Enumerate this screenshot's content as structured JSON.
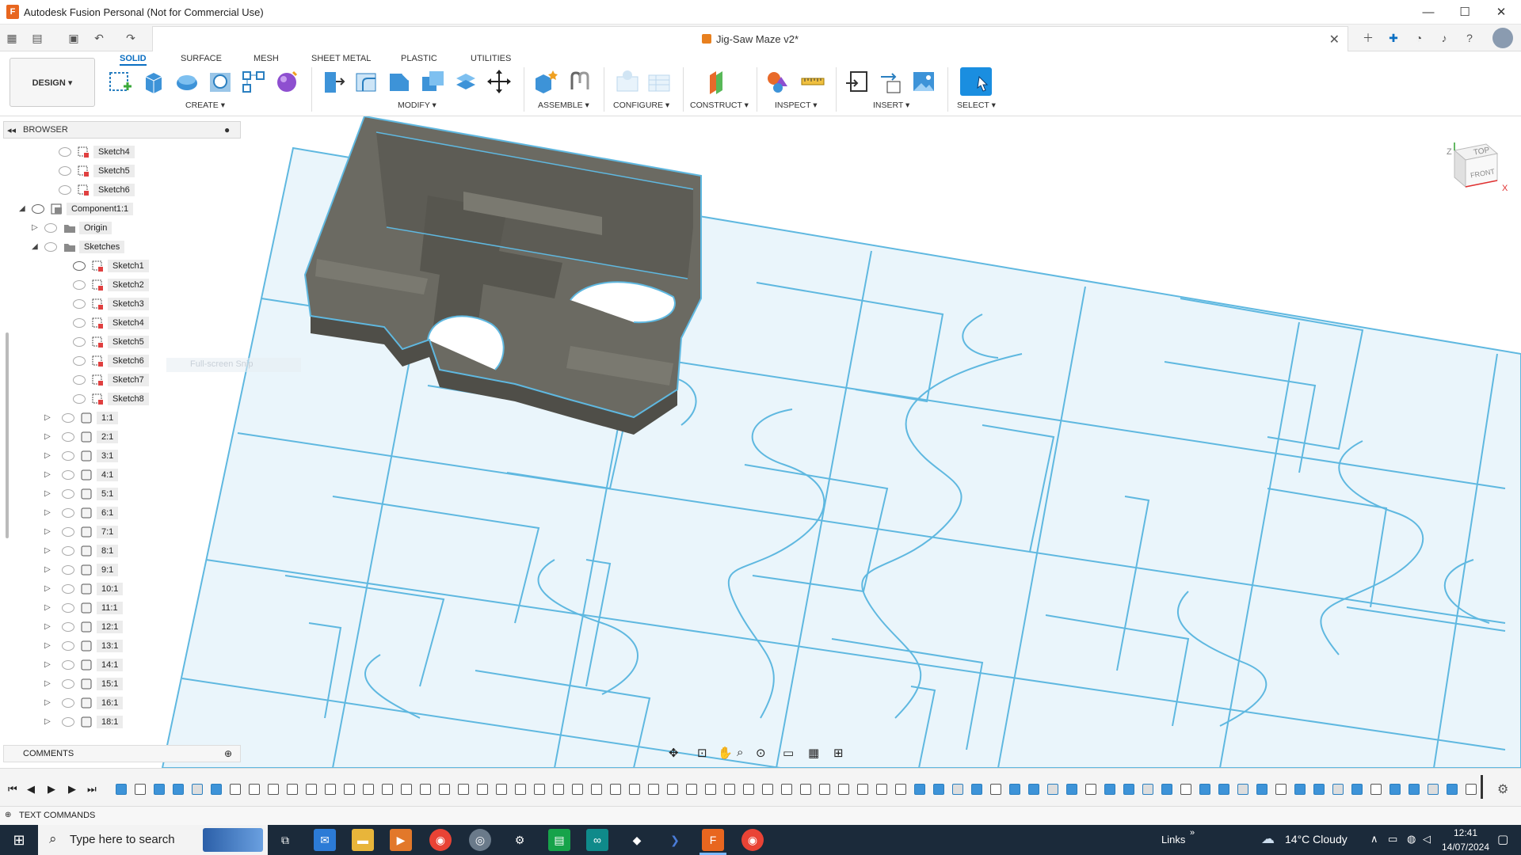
{
  "window": {
    "title": "Autodesk Fusion Personal (Not for Commercial Use)",
    "min": "—",
    "max": "☐",
    "close": "✕"
  },
  "document": {
    "tab_title": "Jig-Saw Maze v2*",
    "close": "✕"
  },
  "ribbon": {
    "workspace": "DESIGN ▾",
    "tabs": [
      "SOLID",
      "SURFACE",
      "MESH",
      "SHEET METAL",
      "PLASTIC",
      "UTILITIES"
    ],
    "active_tab": "SOLID",
    "groups": [
      "CREATE ▾",
      "MODIFY ▾",
      "ASSEMBLE ▾",
      "CONFIGURE ▾",
      "CONSTRUCT ▾",
      "INSPECT ▾",
      "INSERT ▾",
      "SELECT ▾"
    ]
  },
  "browser": {
    "title": "BROWSER",
    "rows": [
      {
        "label": "Sketch4"
      },
      {
        "label": "Sketch5"
      },
      {
        "label": "Sketch6"
      },
      {
        "label": "Component1:1"
      },
      {
        "label": "Origin"
      },
      {
        "label": "Sketches"
      },
      {
        "label": "Sketch1"
      },
      {
        "label": "Sketch2"
      },
      {
        "label": "Sketch3"
      },
      {
        "label": "Sketch4"
      },
      {
        "label": "Sketch5"
      },
      {
        "label": "Sketch6"
      },
      {
        "label": "Sketch7"
      },
      {
        "label": "Sketch8"
      },
      {
        "label": "1:1"
      },
      {
        "label": "2:1"
      },
      {
        "label": "3:1"
      },
      {
        "label": "4:1"
      },
      {
        "label": "5:1"
      },
      {
        "label": "6:1"
      },
      {
        "label": "7:1"
      },
      {
        "label": "8:1"
      },
      {
        "label": "9:1"
      },
      {
        "label": "10:1"
      },
      {
        "label": "11:1"
      },
      {
        "label": "12:1"
      },
      {
        "label": "13:1"
      },
      {
        "label": "14:1"
      },
      {
        "label": "15:1"
      },
      {
        "label": "16:1"
      },
      {
        "label": "18:1"
      }
    ],
    "ghost_tooltip": "Full-screen Snip"
  },
  "comments": {
    "title": "COMMENTS"
  },
  "viewcube": {
    "top": "TOP",
    "front": "FRONT",
    "axis_x": "X",
    "axis_z": "Z"
  },
  "text_commands": {
    "title": "TEXT COMMANDS"
  },
  "taskbar": {
    "search_placeholder": "Type here to search",
    "links": "Links",
    "weather": "14°C  Cloudy",
    "time": "12:41",
    "date": "14/07/2024"
  },
  "colors": {
    "accent": "#0a6ec2",
    "sketch_line": "#5fb8e0",
    "body": "#6b6a62",
    "plate": "#eaf5fb"
  }
}
